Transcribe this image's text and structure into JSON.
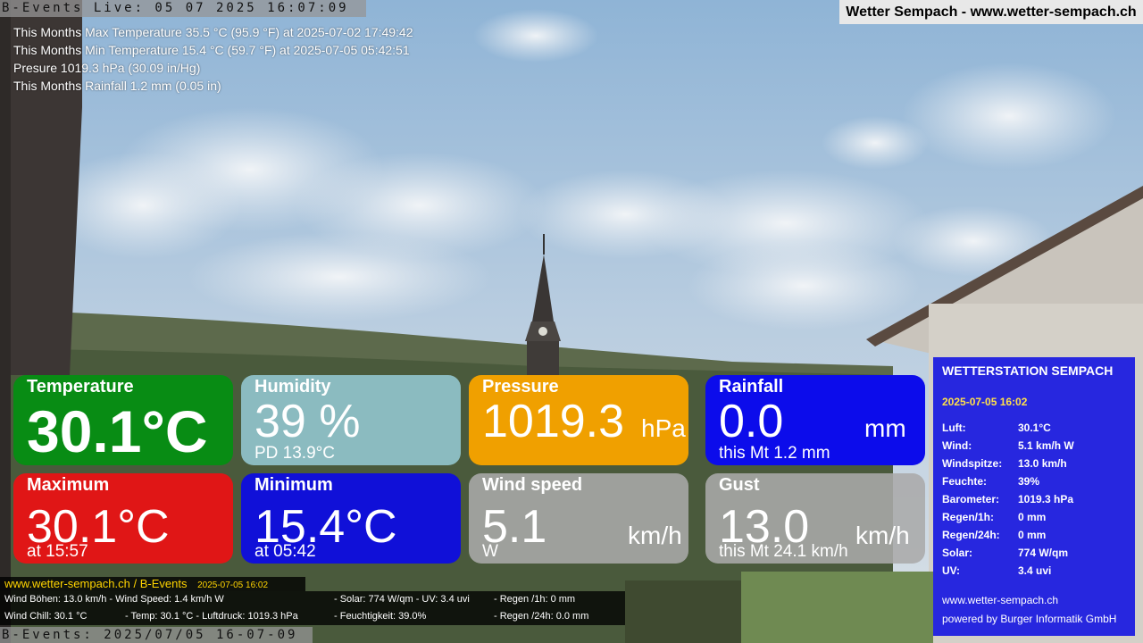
{
  "overlay": {
    "live_banner": "B-Events Live: 05 07 2025 16:07:09",
    "site_title": "Wetter Sempach - www.wetter-sempach.ch",
    "month_stats": [
      "This Months Max Temperature 35.5 °C (95.9 °F) at 2025-07-02 17:49:42",
      "This Months Min Temperature 15.4 °C (59.7 °F) at 2025-07-05 05:42:51",
      "Presure 1019.3 hPa (30.09 in/Hg)",
      "This Months Rainfall 1.2 mm (0.05 in)"
    ]
  },
  "tiles": {
    "temperature": {
      "label": "Temperature",
      "value": "30.1°C",
      "color": "#088c14"
    },
    "humidity": {
      "label": "Humidity",
      "value": "39 %",
      "sub": "PD 13.9°C"
    },
    "pressure": {
      "label": "Pressure",
      "value": "1019.3",
      "unit": "hPa",
      "color": "#f0a000"
    },
    "rainfall": {
      "label": "Rainfall",
      "value": "0.0",
      "unit": "mm",
      "sub": "this Mt 1.2 mm"
    },
    "maximum": {
      "label": "Maximum",
      "value": "30.1°C",
      "sub": "at 15:57",
      "color": "#e01616"
    },
    "minimum": {
      "label": "Minimum",
      "value": "15.4°C",
      "sub": "at 05:42"
    },
    "wind_speed": {
      "label": "Wind speed",
      "value": "5.1",
      "unit": "km/h",
      "sub": "W"
    },
    "gust": {
      "label": "Gust",
      "value": "13.0",
      "unit": "km/h",
      "sub": "this Mt 24.1 km/h"
    }
  },
  "station": {
    "title": "WETTERSTATION SEMPACH",
    "date": "2025-07-05 16:02",
    "rows": [
      {
        "k": "Luft:",
        "v": "30.1°C"
      },
      {
        "k": "Wind:",
        "v": "5.1 km/h  W"
      },
      {
        "k": "Windspitze:",
        "v": "13.0 km/h"
      },
      {
        "k": "Feuchte:",
        "v": "39%"
      },
      {
        "k": "Barometer:",
        "v": "1019.3 hPa"
      },
      {
        "k": "Regen/1h:",
        "v": "0 mm"
      },
      {
        "k": "Regen/24h:",
        "v": "0 mm"
      },
      {
        "k": "Solar:",
        "v": "774 W/qm"
      },
      {
        "k": "UV:",
        "v": "3.4 uvi"
      }
    ],
    "footer_url": "www.wetter-sempach.ch",
    "footer_credit": "powered by Burger Informatik GmbH"
  },
  "ticker": {
    "url": "www.wetter-sempach.ch / B-Events",
    "date": "2025-07-05 16:02",
    "line1": {
      "a": "Wind Böhen: 13.0 km/h  - Wind Speed: 1.4 km/h W",
      "b": "- Solar: 774 W/qm   - UV: 3.4 uvi",
      "c": "- Regen /1h:   0 mm"
    },
    "line2": {
      "a": "Wind Chill: 30.1 °C",
      "b": "- Temp: 30.1 °C  - Luftdruck: 1019.3 hPa",
      "c": "- Feuchtigkeit: 39.0%",
      "d": "- Regen /24h: 0.0 mm"
    }
  },
  "bottom_banner": "B-Events: 2025/07/05 16-07-09"
}
